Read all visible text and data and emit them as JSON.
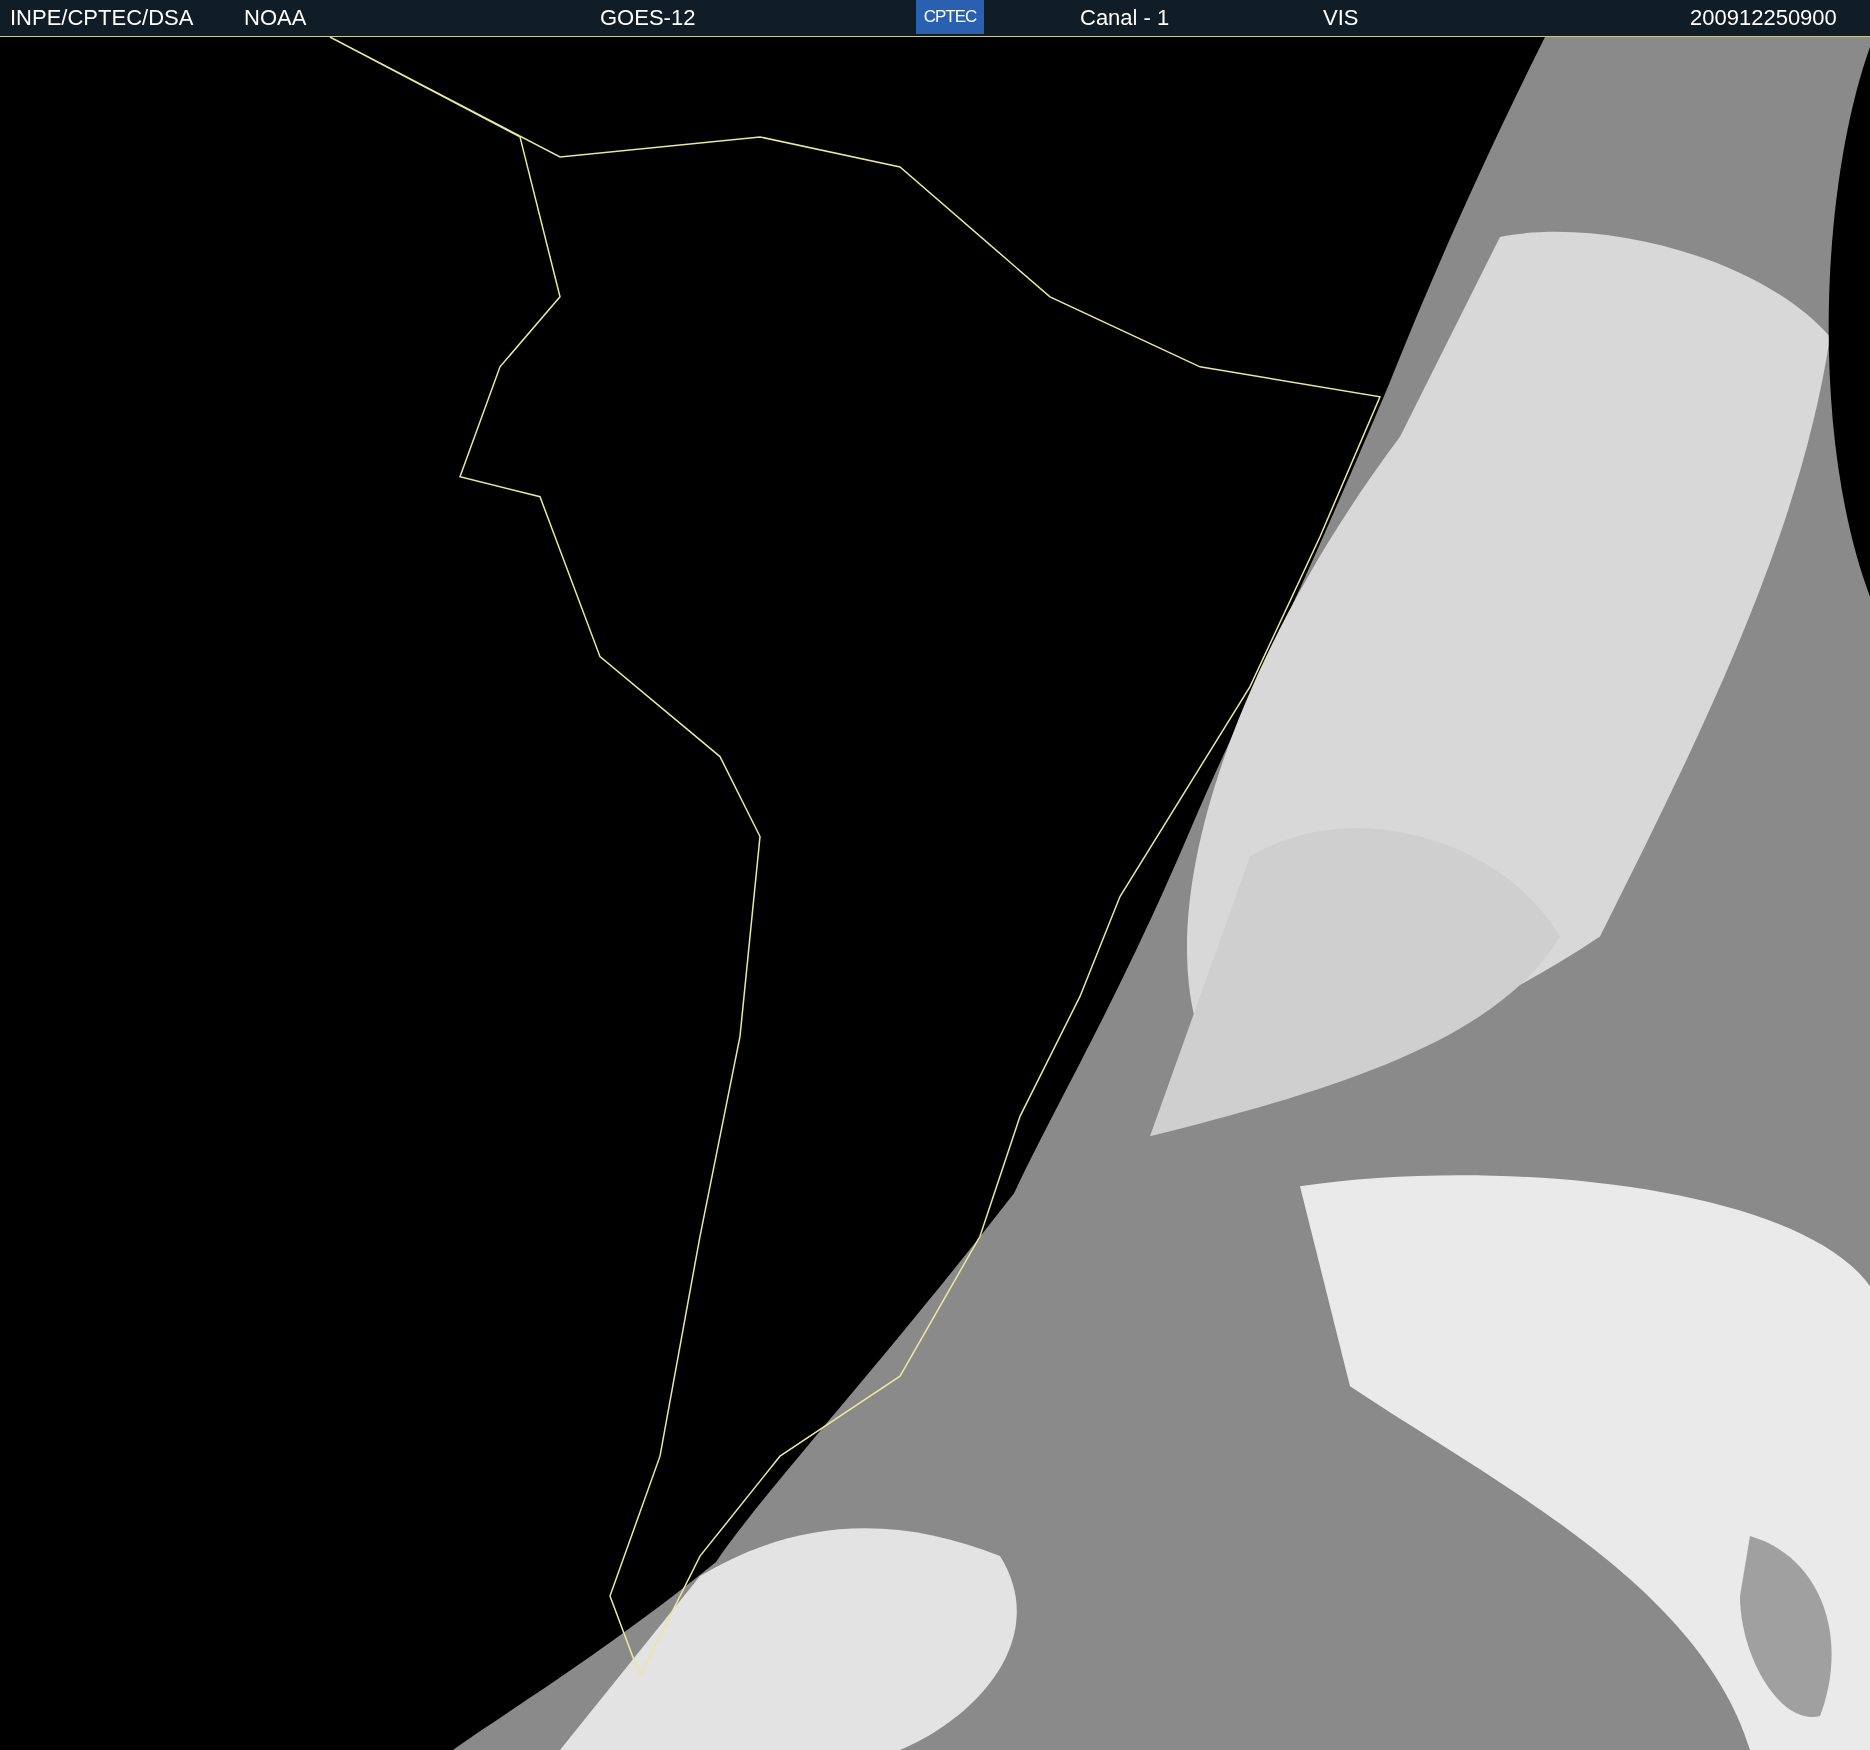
{
  "header": {
    "items": [
      {
        "kind": "text",
        "text": "INPE/CPTEC/DSA"
      },
      {
        "kind": "text",
        "text": "NOAA"
      },
      {
        "kind": "text",
        "text": "GOES-12"
      },
      {
        "kind": "logo",
        "text": "CPTEC"
      },
      {
        "kind": "text",
        "text": "Canal - 1"
      },
      {
        "kind": "text",
        "text": "VIS"
      },
      {
        "kind": "text",
        "text": "200912250900"
      }
    ]
  }
}
